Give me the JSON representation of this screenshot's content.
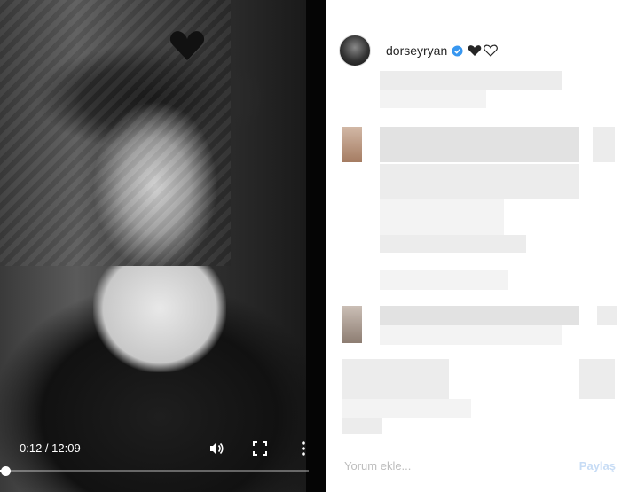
{
  "video": {
    "time_display": "0:12 / 12:09",
    "progress": 0.0165,
    "icons": [
      "volume-icon",
      "fullscreen-icon",
      "more-options-icon"
    ]
  },
  "post": {
    "username": "dorseyryan",
    "verified": true,
    "emoji_hearts": [
      "black-heart",
      "white-heart"
    ]
  },
  "comment_box": {
    "placeholder": "Yorum ekle...",
    "post_label": "Paylaş"
  },
  "colors": {
    "verified_blue": "#3897f0",
    "post_button": "#c7dcf5"
  }
}
